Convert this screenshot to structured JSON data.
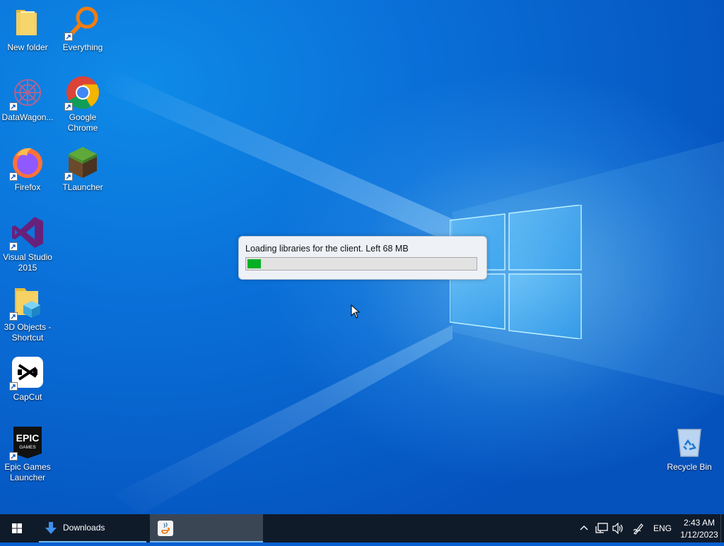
{
  "desktop": {
    "icons": [
      {
        "label": "New folder",
        "icon": "folder-icon"
      },
      {
        "label": "Everything",
        "icon": "everything-search-icon"
      },
      {
        "label": "DataWagon...",
        "icon": "datawagon-icon"
      },
      {
        "label": "Google Chrome",
        "icon": "chrome-icon"
      },
      {
        "label": "Firefox",
        "icon": "firefox-icon"
      },
      {
        "label": "TLauncher",
        "icon": "tlauncher-icon"
      },
      {
        "label": "Visual Studio 2015",
        "icon": "visual-studio-icon"
      },
      {
        "label": "3D Objects - Shortcut",
        "icon": "3d-objects-folder-icon"
      },
      {
        "label": "CapCut",
        "icon": "capcut-icon"
      },
      {
        "label": "Epic Games Launcher",
        "icon": "epic-games-icon"
      },
      {
        "label": "Recycle Bin",
        "icon": "recycle-bin-icon"
      }
    ],
    "epic_logo_text": [
      "EPIC",
      "GAMES"
    ]
  },
  "loader": {
    "message": "Loading libraries for the client. Left 68 MB",
    "progress": 0.06
  },
  "taskbar": {
    "start": "windows-start-icon",
    "downloads_label": "Downloads",
    "java_app": "java-icon",
    "tray": {
      "language": "ENG",
      "time": "2:43 AM",
      "date": "1/12/2023"
    }
  },
  "colors": {
    "progress_green": "#06b025",
    "taskbar": "#101b2a",
    "accent": "#76b9ed"
  }
}
